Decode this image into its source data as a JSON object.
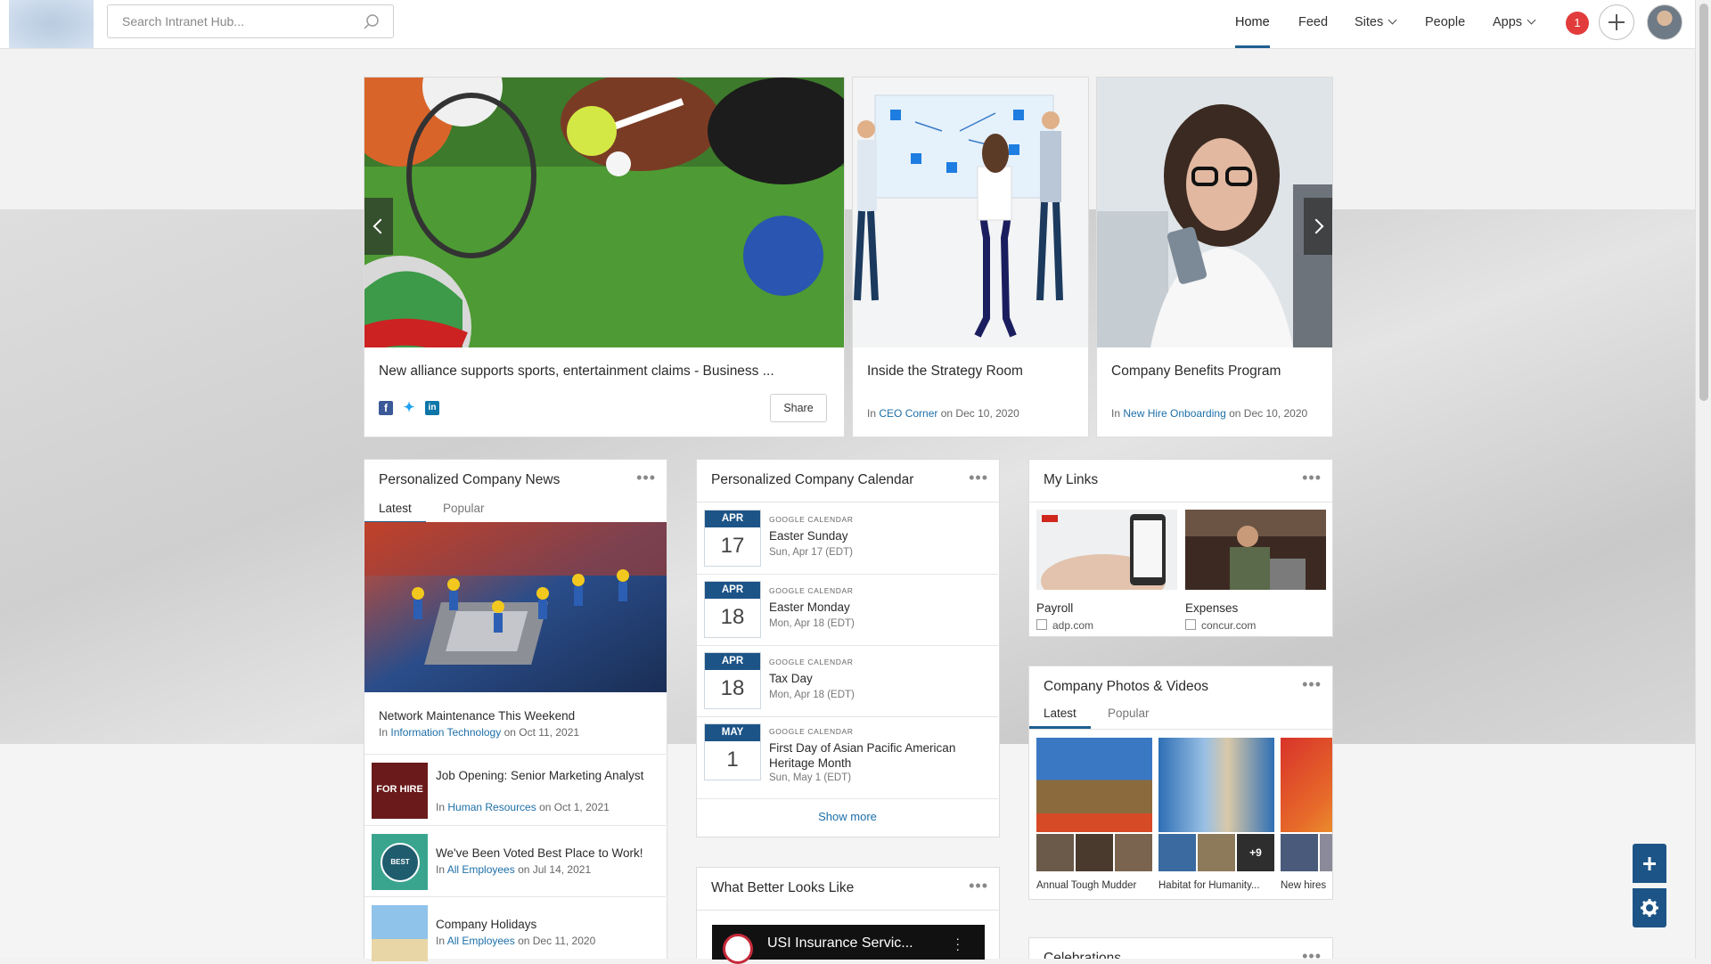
{
  "search": {
    "placeholder": "Search Intranet Hub..."
  },
  "nav": {
    "home": "Home",
    "feed": "Feed",
    "sites": "Sites",
    "people": "People",
    "apps": "Apps",
    "notifications_count": "1"
  },
  "carousel": {
    "slides": [
      {
        "title": "New alliance supports sports, entertainment claims - Business ...",
        "share_label": "Share"
      },
      {
        "title": "Inside the Strategy Room",
        "in": "In",
        "site": "CEO Corner",
        "date": "on Dec 10, 2020"
      },
      {
        "title": "Company Benefits Program",
        "in": "In",
        "site": "New Hire Onboarding",
        "date": "on Dec 10, 2020"
      }
    ]
  },
  "news": {
    "title": "Personalized Company News",
    "tabs": [
      "Latest",
      "Popular"
    ],
    "featured": {
      "title": "Network Maintenance This Weekend",
      "in": "In",
      "site": "Information Technology",
      "date": "on Oct 11, 2021"
    },
    "items": [
      {
        "title": "Job Opening: Senior Marketing Analyst",
        "in": "In",
        "site": "Human Resources",
        "date": "on Oct 1, 2021",
        "thumb_text": "FOR HIRE"
      },
      {
        "title": "We've Been Voted Best Place to Work!",
        "in": "In",
        "site": "All Employees",
        "date": "on Jul 14, 2021",
        "thumb_text": "BEST"
      },
      {
        "title": "Company Holidays",
        "in": "In",
        "site": "All Employees",
        "date": "on Dec 11, 2020"
      }
    ]
  },
  "calendar": {
    "title": "Personalized Company Calendar",
    "events": [
      {
        "month": "APR",
        "day": "17",
        "source": "GOOGLE CALENDAR",
        "title": "Easter Sunday",
        "when": "Sun, Apr 17 (EDT)"
      },
      {
        "month": "APR",
        "day": "18",
        "source": "GOOGLE CALENDAR",
        "title": "Easter Monday",
        "when": "Mon, Apr 18 (EDT)"
      },
      {
        "month": "APR",
        "day": "18",
        "source": "GOOGLE CALENDAR",
        "title": "Tax Day",
        "when": "Mon, Apr 18 (EDT)"
      },
      {
        "month": "MAY",
        "day": "1",
        "source": "GOOGLE CALENDAR",
        "title": "First Day of Asian Pacific American Heritage Month",
        "when": "Sun, May 1 (EDT)"
      }
    ],
    "show_more": "Show more"
  },
  "video": {
    "title": "What Better Looks Like",
    "video_title": "USI Insurance Servic..."
  },
  "links": {
    "title": "My Links",
    "items": [
      {
        "name": "Payroll",
        "url": "adp.com"
      },
      {
        "name": "Expenses",
        "url": "concur.com"
      }
    ]
  },
  "photos": {
    "title": "Company Photos & Videos",
    "tabs": [
      "Latest",
      "Popular"
    ],
    "albums": [
      {
        "name": "Annual Tough Mudder"
      },
      {
        "name": "Habitat for Humanity...",
        "more": "+9"
      },
      {
        "name": "New hires"
      }
    ]
  },
  "celebrations": {
    "title": "Celebrations"
  },
  "colors": {
    "accent": "#1f5f8f",
    "link": "#1d6fa8",
    "badge": "#e23b3b",
    "calendar": "#1d5487"
  }
}
